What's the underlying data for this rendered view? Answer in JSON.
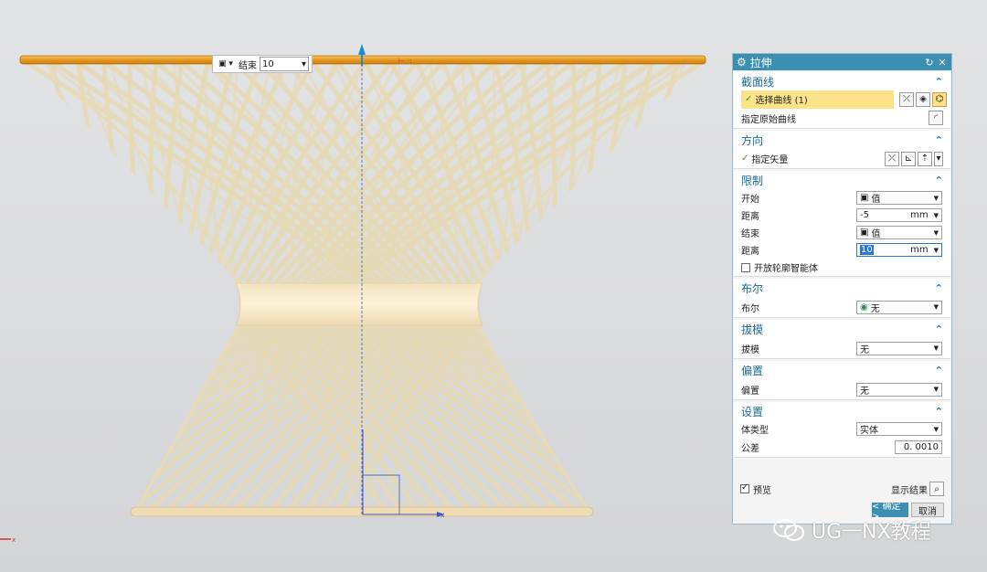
{
  "toolbar_float": {
    "end_label": "结束",
    "end_value": "10"
  },
  "dialog": {
    "title": "拉伸",
    "sections": {
      "section_curve": {
        "header": "截面线",
        "select_curve": "选择曲线 (1)",
        "specify_origin": "指定原始曲线"
      },
      "direction": {
        "header": "方向",
        "specify_vector": "指定矢量"
      },
      "limits": {
        "header": "限制",
        "start_label": "开始",
        "start_value": "值",
        "dist1_label": "距离",
        "dist1_value": "-5",
        "dist1_unit": "mm",
        "end_label": "结束",
        "end_value": "值",
        "dist2_label": "距离",
        "dist2_value": "10",
        "dist2_unit": "mm",
        "open_profile": "开放轮廓智能体"
      },
      "boolean": {
        "header": "布尔",
        "label": "布尔",
        "value": "无"
      },
      "draft": {
        "header": "拔模",
        "label": "拔模",
        "value": "无"
      },
      "offset": {
        "header": "偏置",
        "label": "偏置",
        "value": "无"
      },
      "settings": {
        "header": "设置",
        "body_type_label": "体类型",
        "body_type_value": "实体",
        "tolerance_label": "公差",
        "tolerance_value": "0. 0010"
      }
    },
    "preview_label": "预览",
    "show_result": "显示结果",
    "ok_label": "< 确定 >",
    "cancel_label": "取消"
  },
  "watermark": "UG一NX教程",
  "colors": {
    "title_bar": "#3b8fb3",
    "section_header_text": "#1b6c9a",
    "selection_highlight": "#fce38a",
    "lattice": "#e6d9b4",
    "top_bar": "#f0a02a"
  }
}
